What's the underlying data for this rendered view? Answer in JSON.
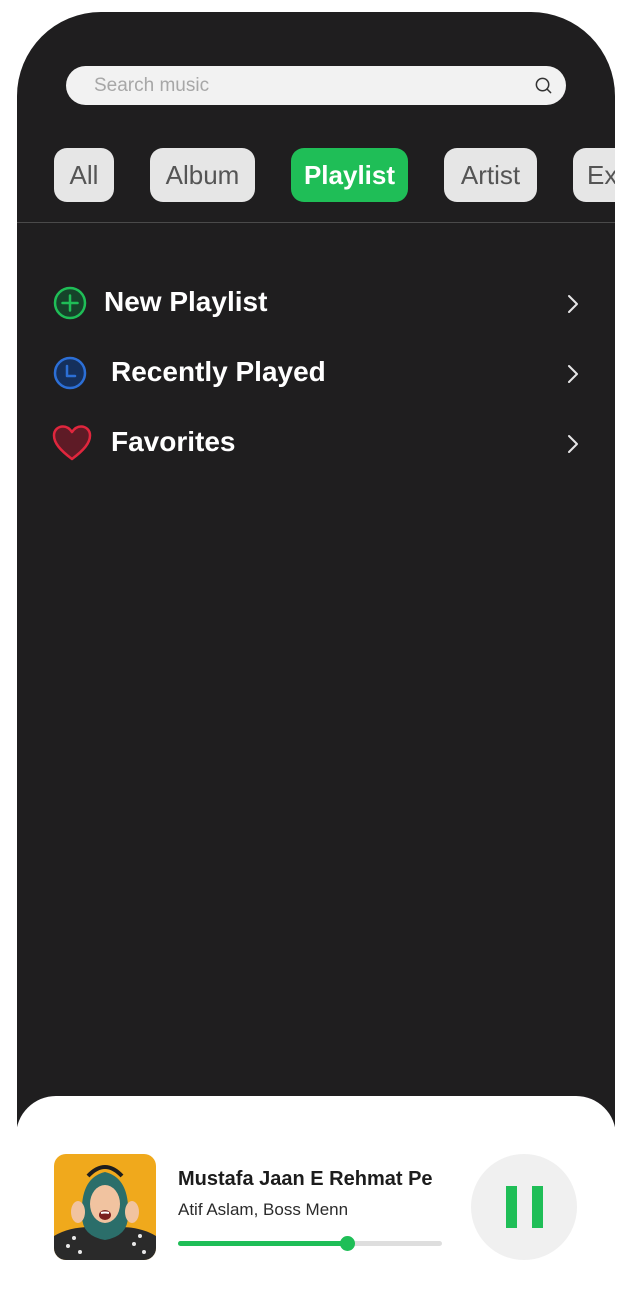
{
  "search": {
    "placeholder": "Search music",
    "icon": "search-icon"
  },
  "filters": [
    {
      "label": "All",
      "active": false
    },
    {
      "label": "Album",
      "active": false
    },
    {
      "label": "Playlist",
      "active": true
    },
    {
      "label": "Artist",
      "active": false
    },
    {
      "label": "Explore",
      "active": false
    }
  ],
  "menu": [
    {
      "label": "New Playlist",
      "icon": "plus-circle-icon"
    },
    {
      "label": "Recently Played",
      "icon": "clock-icon"
    },
    {
      "label": "Favorites",
      "icon": "heart-icon"
    }
  ],
  "player": {
    "title": "Mustafa Jaan E Rehmat Pe",
    "artist": "Atif Aslam, Boss Menn",
    "progress": 0.64,
    "state_icon": "pause-icon"
  },
  "colors": {
    "accent": "#1fbe57",
    "background": "#1f1e1f",
    "clock": "#2c6fd6",
    "heart": "#e0263d"
  }
}
